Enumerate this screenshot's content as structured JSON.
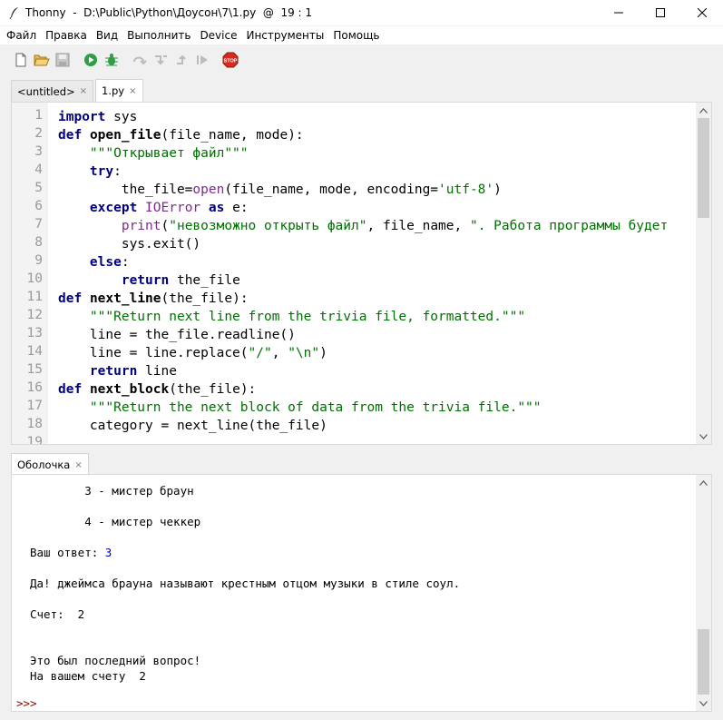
{
  "window": {
    "title": "Thonny  -  D:\\Public\\Python\\Доусон\\7\\1.py  @  19 : 1"
  },
  "menu": [
    "Файл",
    "Правка",
    "Вид",
    "Выполнить",
    "Device",
    "Инструменты",
    "Помощь"
  ],
  "toolbar": {
    "icons": [
      "new-file-icon",
      "open-file-icon",
      "save-icon",
      "run-icon",
      "debug-icon",
      "step-over-icon",
      "step-into-icon",
      "step-out-icon",
      "resume-icon",
      "stop-icon"
    ],
    "stop_label": "STOP"
  },
  "editor_tabs": [
    {
      "label": "<untitled>",
      "close": "×"
    },
    {
      "label": "1.py",
      "close": "×"
    }
  ],
  "editor": {
    "line_numbers": [
      "1",
      "2",
      "3",
      "4",
      "5",
      "6",
      "7",
      "8",
      "9",
      "10",
      "11",
      "12",
      "13",
      "14",
      "15",
      "16",
      "17",
      "18",
      "19"
    ],
    "lines": [
      [
        {
          "t": "import",
          "c": "kw"
        },
        {
          "t": " sys"
        }
      ],
      [
        {
          "t": "def",
          "c": "kw"
        },
        {
          "t": " "
        },
        {
          "t": "open_file",
          "c": "fn"
        },
        {
          "t": "(file_name, mode):"
        }
      ],
      [
        {
          "t": "    "
        },
        {
          "t": "\"\"\"Открывает файл\"\"\"",
          "c": "st"
        }
      ],
      [
        {
          "t": "    "
        },
        {
          "t": "try",
          "c": "kw"
        },
        {
          "t": ":"
        }
      ],
      [
        {
          "t": "        the_file="
        },
        {
          "t": "open",
          "c": "bi"
        },
        {
          "t": "(file_name, mode, encoding="
        },
        {
          "t": "'utf-8'",
          "c": "st"
        },
        {
          "t": ")"
        }
      ],
      [
        {
          "t": "    "
        },
        {
          "t": "except",
          "c": "kw"
        },
        {
          "t": " "
        },
        {
          "t": "IOError",
          "c": "ex"
        },
        {
          "t": " "
        },
        {
          "t": "as",
          "c": "kw"
        },
        {
          "t": " e:"
        }
      ],
      [
        {
          "t": "        "
        },
        {
          "t": "print",
          "c": "bi"
        },
        {
          "t": "("
        },
        {
          "t": "\"невозможно открыть файл\"",
          "c": "st"
        },
        {
          "t": ", file_name, "
        },
        {
          "t": "\". Работа программы будет",
          "c": "st"
        }
      ],
      [
        {
          "t": "        sys.exit()"
        }
      ],
      [
        {
          "t": "    "
        },
        {
          "t": "else",
          "c": "kw"
        },
        {
          "t": ":"
        }
      ],
      [
        {
          "t": "        "
        },
        {
          "t": "return",
          "c": "kw"
        },
        {
          "t": " the_file"
        }
      ],
      [
        {
          "t": "def",
          "c": "kw"
        },
        {
          "t": " "
        },
        {
          "t": "next_line",
          "c": "fn"
        },
        {
          "t": "(the_file):"
        }
      ],
      [
        {
          "t": "    "
        },
        {
          "t": "\"\"\"Return next line from the trivia file, formatted.\"\"\"",
          "c": "st"
        }
      ],
      [
        {
          "t": "    line = the_file.readline()"
        }
      ],
      [
        {
          "t": "    line = line.replace("
        },
        {
          "t": "\"/\"",
          "c": "st"
        },
        {
          "t": ", "
        },
        {
          "t": "\"\\n\"",
          "c": "st"
        },
        {
          "t": ")"
        }
      ],
      [
        {
          "t": "    "
        },
        {
          "t": "return",
          "c": "kw"
        },
        {
          "t": " line"
        }
      ],
      [
        {
          "t": "def",
          "c": "kw"
        },
        {
          "t": " "
        },
        {
          "t": "next_block",
          "c": "fn"
        },
        {
          "t": "(the_file):"
        }
      ],
      [
        {
          "t": "    "
        },
        {
          "t": "\"\"\"Return the next block of data from the trivia file.\"\"\"",
          "c": "st"
        }
      ],
      [
        {
          "t": "    category = next_line(the_file)"
        }
      ],
      [
        {
          "t": ""
        }
      ]
    ]
  },
  "shell_tab": {
    "label": "Оболочка",
    "close": "×"
  },
  "shell": {
    "lines": [
      {
        "text": "        3 - мистер браун"
      },
      {
        "text": "        4 - мистер чеккер"
      },
      {
        "text": "Ваш ответ: ",
        "input": "3"
      },
      {
        "text": "Да! джеймса брауна называют крестным отцом музыки в стиле соул."
      },
      {
        "text": "Счет:  2"
      },
      {
        "text": "Это был последний вопрос!"
      },
      {
        "text": "На вашем счету  2"
      }
    ],
    "prompt": ">>>"
  }
}
